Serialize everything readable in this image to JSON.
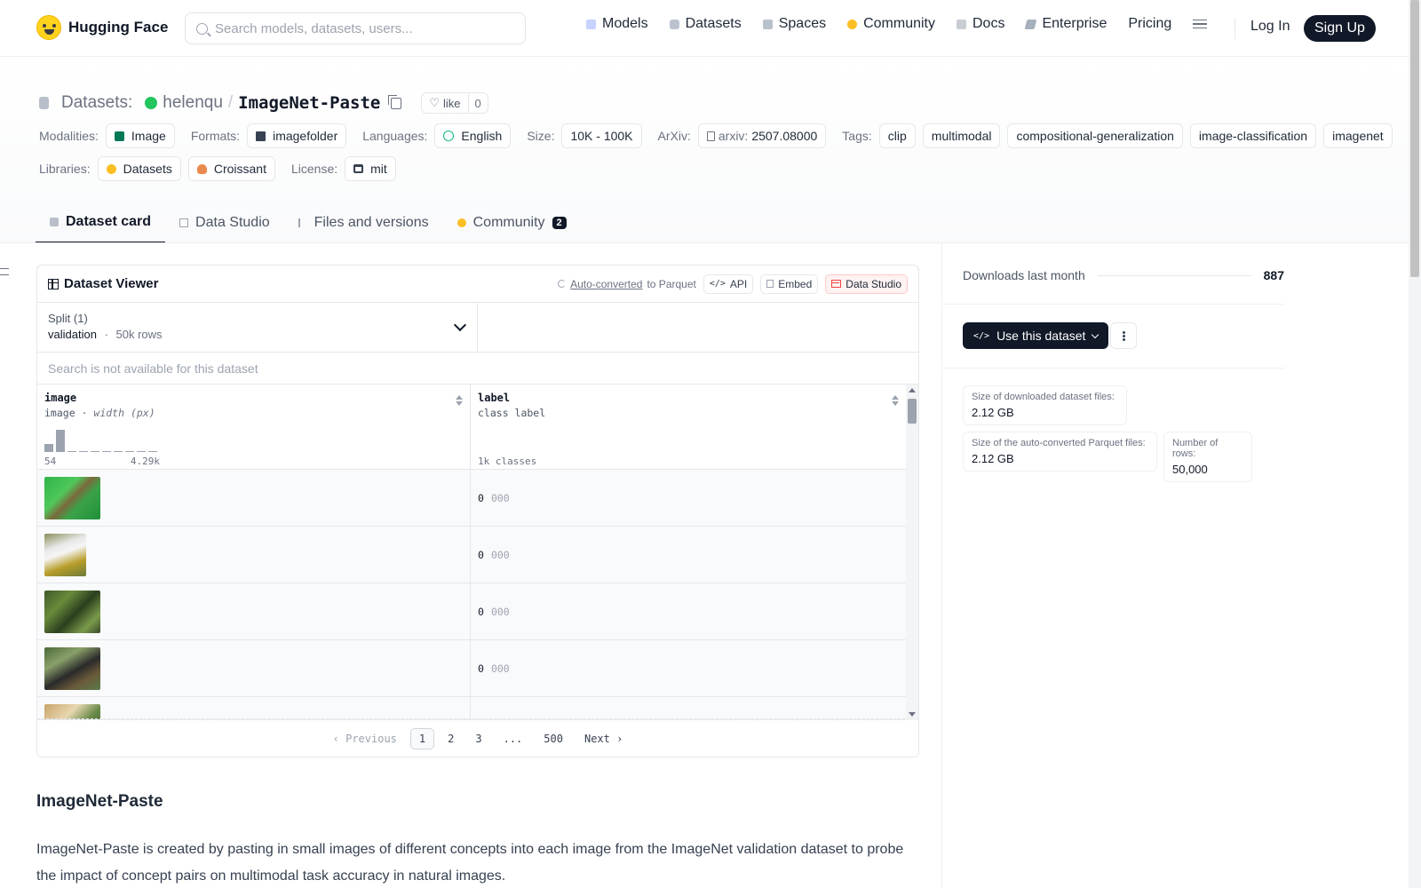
{
  "nav": {
    "brand": "Hugging Face",
    "search_placeholder": "Search models, datasets, users...",
    "links": [
      "Models",
      "Datasets",
      "Spaces",
      "Community",
      "Docs",
      "Enterprise",
      "Pricing"
    ],
    "login": "Log In",
    "signup": "Sign Up"
  },
  "repo": {
    "kind": "Datasets:",
    "owner": "helenqu",
    "slash": "/",
    "name": "ImageNet-Paste",
    "like_label": "like",
    "like_count": "0"
  },
  "meta": {
    "modalities_label": "Modalities:",
    "modality": "Image",
    "formats_label": "Formats:",
    "format": "imagefolder",
    "languages_label": "Languages:",
    "language": "English",
    "size_label": "Size:",
    "size": "10K - 100K",
    "arxiv_label": "ArXiv:",
    "arxiv_prefix": "arxiv:",
    "arxiv_id": "2507.08000",
    "tags_label": "Tags:",
    "tags": [
      "clip",
      "multimodal",
      "compositional-generalization",
      "image-classification",
      "imagenet"
    ],
    "libraries_label": "Libraries:",
    "libraries": [
      "Datasets",
      "Croissant"
    ],
    "license_label": "License:",
    "license": "mit"
  },
  "tabs": [
    {
      "label": "Dataset card"
    },
    {
      "label": "Data Studio"
    },
    {
      "label": "Files and versions"
    },
    {
      "label": "Community",
      "badge": "2"
    }
  ],
  "viewer": {
    "title": "Dataset Viewer",
    "auto_converted": "Auto-converted",
    "to_parquet": "to Parquet",
    "api": "API",
    "embed": "Embed",
    "data_studio": "Data Studio",
    "split_label": "Split (1)",
    "split_value": "validation",
    "split_sep": "·",
    "split_rows": "50k rows",
    "search_na": "Search is not available for this dataset",
    "columns": {
      "image": {
        "name": "image",
        "type": "image",
        "sub": "· width (px)",
        "min": "54",
        "max": "4.29k"
      },
      "label": {
        "name": "label",
        "type": "class label",
        "classes": "1k classes"
      }
    },
    "histogram": [
      0.35,
      0.95,
      0,
      0,
      0,
      0,
      0,
      0,
      0,
      0
    ],
    "rows": [
      {
        "label": "0",
        "class": "000"
      },
      {
        "label": "0",
        "class": "000"
      },
      {
        "label": "0",
        "class": "000"
      },
      {
        "label": "0",
        "class": "000"
      }
    ],
    "pager": {
      "prev": "Previous",
      "pages": [
        "1",
        "2",
        "3",
        "...",
        "500"
      ],
      "next": "Next"
    }
  },
  "card": {
    "heading": "ImageNet-Paste",
    "paragraph": "ImageNet-Paste is created by pasting in small images of different concepts into each image from the ImageNet validation dataset to probe the impact of concept pairs on multimodal task accuracy in natural images."
  },
  "sidebar": {
    "downloads_label": "Downloads last month",
    "downloads_value": "887",
    "use_button": "Use this dataset",
    "stats": [
      {
        "label": "Size of downloaded dataset files:",
        "value": "2.12 GB"
      },
      {
        "label": "Size of the auto-converted Parquet files:",
        "value": "2.12 GB"
      },
      {
        "label": "Number of rows:",
        "value": "50,000"
      }
    ]
  }
}
